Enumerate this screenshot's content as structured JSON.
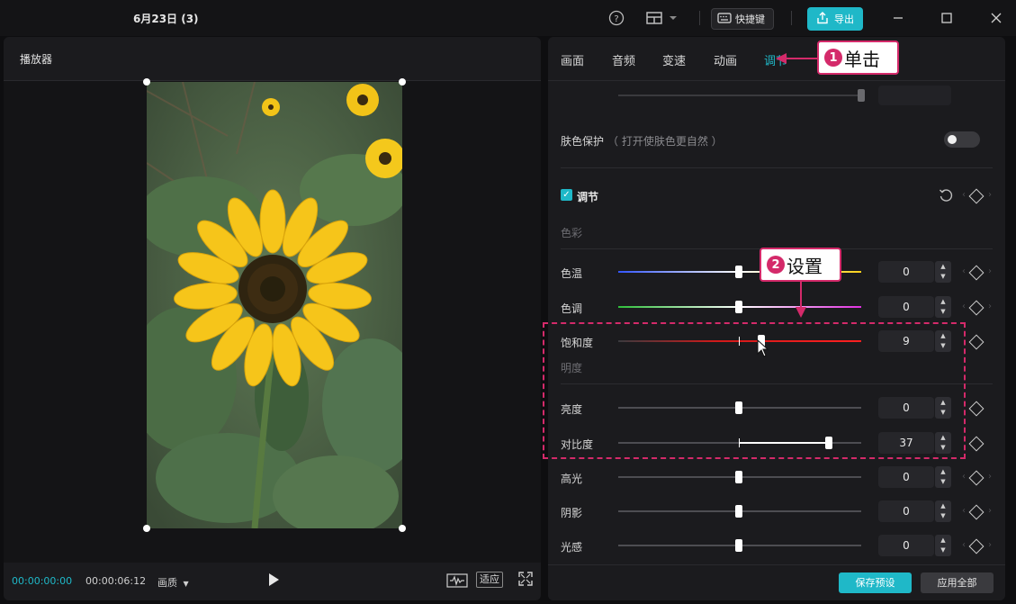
{
  "window": {
    "title": "6月23日 (3)"
  },
  "toolbar": {
    "shortcuts_label": "快捷键",
    "export_label": "导出"
  },
  "player": {
    "title": "播放器",
    "current_time": "00:00:00:00",
    "total_time": "00:00:06:12",
    "quality_label": "画质",
    "fit_label": "适应"
  },
  "tabs": [
    {
      "label": "画面"
    },
    {
      "label": "音频"
    },
    {
      "label": "变速"
    },
    {
      "label": "动画"
    },
    {
      "label": "调节",
      "active": true
    }
  ],
  "adjust": {
    "skin_protect": {
      "label": "肤色保护",
      "hint": "（ 打开使肤色更自然 ）",
      "enabled": false
    },
    "section": {
      "label": "调节",
      "checked": true
    },
    "color_group": "色彩",
    "light_group": "明度",
    "rows": [
      {
        "key": "temperature",
        "label": "色温",
        "value": "0"
      },
      {
        "key": "tint",
        "label": "色调",
        "value": "0"
      },
      {
        "key": "saturation",
        "label": "饱和度",
        "value": "9"
      },
      {
        "key": "brightness",
        "label": "亮度",
        "value": "0"
      },
      {
        "key": "contrast",
        "label": "对比度",
        "value": "37"
      },
      {
        "key": "highlights",
        "label": "高光",
        "value": "0"
      },
      {
        "key": "shadows",
        "label": "阴影",
        "value": "0"
      },
      {
        "key": "exposure",
        "label": "光感",
        "value": "0"
      }
    ]
  },
  "footer": {
    "save_preset": "保存预设",
    "apply_all": "应用全部"
  },
  "callouts": [
    {
      "number": "1",
      "text": "单击"
    },
    {
      "number": "2",
      "text": "设置"
    }
  ],
  "colors": {
    "accent": "#1fb8c8",
    "annotation": "#d42a6a"
  }
}
